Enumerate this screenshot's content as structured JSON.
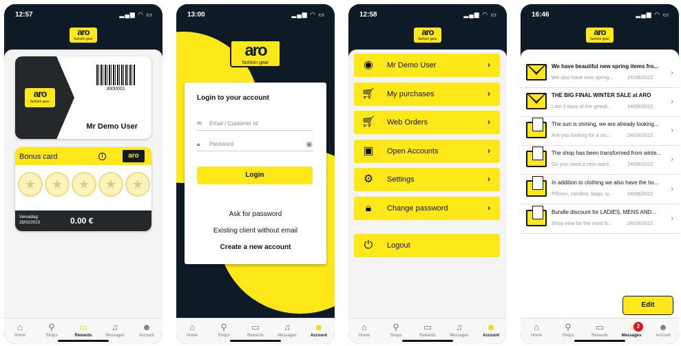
{
  "brand": {
    "name": "aro",
    "tagline": "fashion gear",
    "accent": "#ffe81a",
    "dark": "#0e1a26"
  },
  "tabs": [
    {
      "label": "Home",
      "icon": "home-icon"
    },
    {
      "label": "Shops",
      "icon": "map-pin-icon"
    },
    {
      "label": "Rewards",
      "icon": "card-icon"
    },
    {
      "label": "Messages",
      "icon": "bell-icon"
    },
    {
      "label": "Account",
      "icon": "person-icon"
    }
  ],
  "screen1": {
    "time": "12:57",
    "active_tab": "Rewards",
    "member_card": {
      "barcode_number": "3000001",
      "member_name": "Mr Demo User"
    },
    "bonus_card": {
      "title": "Bonus card",
      "info_glyph": "i",
      "stamps": 5,
      "valid_label": "Vervaldag:",
      "valid_date": "28/02/2023",
      "value": "0.00 €"
    }
  },
  "screen2": {
    "time": "13:00",
    "active_tab": "Account",
    "title": "Login to your account",
    "email_placeholder": "Email / Customer Id",
    "password_placeholder": "Password",
    "login_button": "Login",
    "ask_password": "Ask for password",
    "existing_client": "Existing client without email",
    "create_account": "Create a new account"
  },
  "screen3": {
    "time": "12:58",
    "active_tab": "Account",
    "menu": [
      {
        "label": "Mr Demo User",
        "icon": "user-circle-icon",
        "chevron": true
      },
      {
        "label": "My purchases",
        "icon": "cart-icon",
        "chevron": true
      },
      {
        "label": "Web Orders",
        "icon": "web-cart-icon",
        "chevron": true
      },
      {
        "label": "Open Accounts",
        "icon": "wallet-icon",
        "chevron": true
      },
      {
        "label": "Settings",
        "icon": "gear-icon",
        "chevron": true
      },
      {
        "label": "Change password",
        "icon": "lock-icon",
        "chevron": true
      },
      {
        "label": "Logout",
        "icon": "power-icon",
        "chevron": false
      }
    ]
  },
  "screen4": {
    "time": "16:46",
    "active_tab": "Messages",
    "badge_count": "2",
    "edit_button": "Edit",
    "messages": [
      {
        "title": "We have beautiful new spring items fro...",
        "subtitle": "We also have new spring...",
        "date": "24/08/2022",
        "icon": "envelope-icon",
        "read": false
      },
      {
        "title": "THE BIG FINAL WINTER SALE at ARO",
        "subtitle": "Last 3 days of the grand...",
        "date": "24/08/2022",
        "icon": "envelope-icon",
        "read": false
      },
      {
        "title": "The sun is shining, we are already looking...",
        "subtitle": "Are you looking for a nic...",
        "date": "24/08/2022",
        "icon": "open-envelope-icon",
        "read": true
      },
      {
        "title": "The shop has been transformed from winte...",
        "subtitle": "Do you need a new ward...",
        "date": "24/08/2022",
        "icon": "open-envelope-icon",
        "read": true
      },
      {
        "title": "In addition to clothing we also have the ho...",
        "subtitle": "Pillows, candles, bags, w...",
        "date": "24/08/2022",
        "icon": "open-envelope-icon",
        "read": true
      },
      {
        "title": "Bundle discount for LADIES, MENS AND...",
        "subtitle": "Shop now for the most b...",
        "date": "24/08/2022",
        "icon": "open-envelope-icon",
        "read": true
      }
    ]
  }
}
